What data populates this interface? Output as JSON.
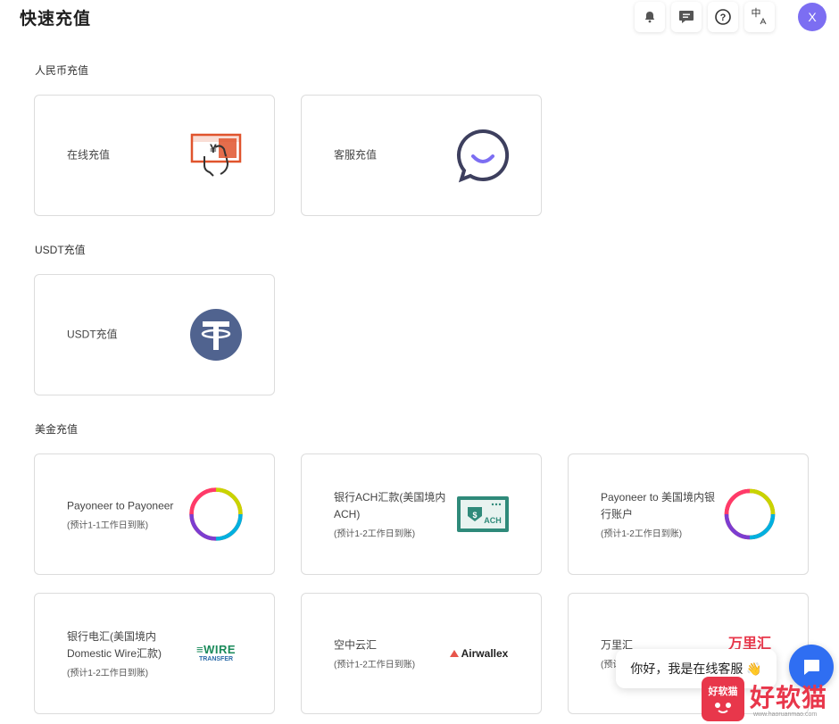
{
  "header": {
    "title": "快速充值",
    "lang_label": "中",
    "avatar_letter": "X"
  },
  "sections": [
    {
      "label": "人民币充值",
      "cards": [
        {
          "title": "在线充值",
          "sub": "",
          "icon": "cash-hand-icon"
        },
        {
          "title": "客服充值",
          "sub": "",
          "icon": "chat-smile-icon"
        }
      ]
    },
    {
      "label": "USDT充值",
      "cards": [
        {
          "title": "USDT充值",
          "sub": "",
          "icon": "tether-icon"
        }
      ]
    },
    {
      "label": "美金充值",
      "cards": [
        {
          "title": "Payoneer to Payoneer",
          "sub": "(预计1-1工作日到账)",
          "icon": "payoneer-icon"
        },
        {
          "title": "银行ACH汇款(美国境内ACH)",
          "sub": "(预计1-2工作日到账)",
          "icon": "ach-icon"
        },
        {
          "title": "Payoneer to 美国境内银行账户",
          "sub": "(预计1-2工作日到账)",
          "icon": "payoneer-icon"
        },
        {
          "title": "银行电汇(美国境内Domestic Wire汇款)",
          "sub": "(预计1-2工作日到账)",
          "icon": "wire-transfer-icon",
          "icon_text": "WIRE TRANSFER"
        },
        {
          "title": "空中云汇",
          "sub": "(预计1-2工作日到账)",
          "icon": "airwallex-icon",
          "icon_text": "Airwallex"
        },
        {
          "title": "万里汇",
          "sub": "(预计",
          "icon": "worldfirst-icon",
          "icon_text": "万里汇"
        }
      ]
    }
  ],
  "chat": {
    "greeting": "你好，我是在线客服 👋"
  },
  "watermark": {
    "logo_text": "好软猫",
    "text": "好软猫",
    "url": "www.haoruanmao.com"
  },
  "colors": {
    "accent": "#7c6ef2",
    "chat_blue": "#2f6ef2",
    "tether": "#50638f",
    "ach_green": "#2f8a7a"
  }
}
